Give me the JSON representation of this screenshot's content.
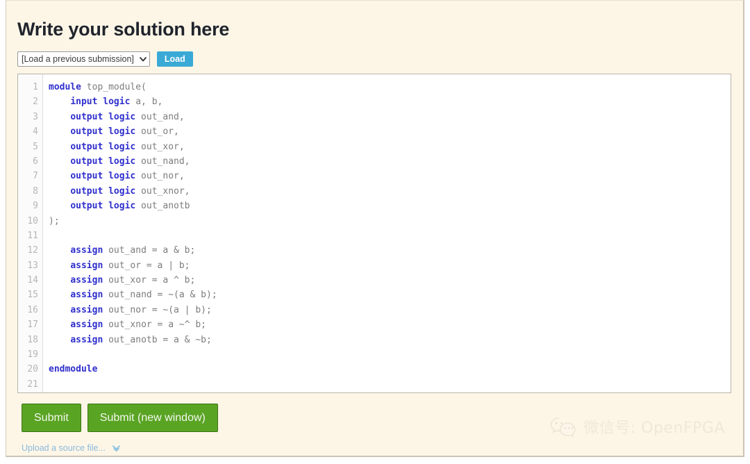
{
  "page": {
    "title": "Write your solution here",
    "background_color": "#fdf6e7"
  },
  "load_row": {
    "select_name": "previous-submission-select",
    "selected_option": "[Load a previous submission]",
    "options": [
      "[Load a previous submission]"
    ],
    "chevron_icon": "chevron-down-icon",
    "load_label": "Load",
    "load_color": "#3aa9d6"
  },
  "editor": {
    "language": "systemverilog",
    "line_count": 21,
    "keyword_color": "#2f2fcd",
    "text_color": "#7c7c7c",
    "gutter_color": "#b6b6b6",
    "line_numbers": [
      1,
      2,
      3,
      4,
      5,
      6,
      7,
      8,
      9,
      10,
      11,
      12,
      13,
      14,
      15,
      16,
      17,
      18,
      19,
      20,
      21
    ],
    "lines": [
      [
        {
          "t": "module",
          "k": true
        },
        {
          "t": " top_module(",
          "k": false
        }
      ],
      [
        {
          "t": "    ",
          "k": false
        },
        {
          "t": "input logic",
          "k": true
        },
        {
          "t": " a, b,",
          "k": false
        }
      ],
      [
        {
          "t": "    ",
          "k": false
        },
        {
          "t": "output logic",
          "k": true
        },
        {
          "t": " out_and,",
          "k": false
        }
      ],
      [
        {
          "t": "    ",
          "k": false
        },
        {
          "t": "output logic",
          "k": true
        },
        {
          "t": " out_or,",
          "k": false
        }
      ],
      [
        {
          "t": "    ",
          "k": false
        },
        {
          "t": "output logic",
          "k": true
        },
        {
          "t": " out_xor,",
          "k": false
        }
      ],
      [
        {
          "t": "    ",
          "k": false
        },
        {
          "t": "output logic",
          "k": true
        },
        {
          "t": " out_nand,",
          "k": false
        }
      ],
      [
        {
          "t": "    ",
          "k": false
        },
        {
          "t": "output logic",
          "k": true
        },
        {
          "t": " out_nor,",
          "k": false
        }
      ],
      [
        {
          "t": "    ",
          "k": false
        },
        {
          "t": "output logic",
          "k": true
        },
        {
          "t": " out_xnor,",
          "k": false
        }
      ],
      [
        {
          "t": "    ",
          "k": false
        },
        {
          "t": "output logic",
          "k": true
        },
        {
          "t": " out_anotb",
          "k": false
        }
      ],
      [
        {
          "t": ");",
          "k": false
        }
      ],
      [],
      [
        {
          "t": "    ",
          "k": false
        },
        {
          "t": "assign",
          "k": true
        },
        {
          "t": " out_and = a & b;",
          "k": false
        }
      ],
      [
        {
          "t": "    ",
          "k": false
        },
        {
          "t": "assign",
          "k": true
        },
        {
          "t": " out_or = a | b;",
          "k": false
        }
      ],
      [
        {
          "t": "    ",
          "k": false
        },
        {
          "t": "assign",
          "k": true
        },
        {
          "t": " out_xor = a ^ b;",
          "k": false
        }
      ],
      [
        {
          "t": "    ",
          "k": false
        },
        {
          "t": "assign",
          "k": true
        },
        {
          "t": " out_nand = ~(a & b);",
          "k": false
        }
      ],
      [
        {
          "t": "    ",
          "k": false
        },
        {
          "t": "assign",
          "k": true
        },
        {
          "t": " out_nor = ~(a | b);",
          "k": false
        }
      ],
      [
        {
          "t": "    ",
          "k": false
        },
        {
          "t": "assign",
          "k": true
        },
        {
          "t": " out_xnor = a ~^ b;",
          "k": false
        }
      ],
      [
        {
          "t": "    ",
          "k": false
        },
        {
          "t": "assign",
          "k": true
        },
        {
          "t": " out_anotb = a & ~b;",
          "k": false
        }
      ],
      [],
      [
        {
          "t": "endmodule",
          "k": true
        }
      ],
      []
    ]
  },
  "buttons": {
    "submit_label": "Submit",
    "submit_new_window_label": "Submit (new window)",
    "color": "#5aa424"
  },
  "upload": {
    "label": "Upload a source file...",
    "chevron_icon": "double-chevron-down-icon",
    "color": "#8ab9dc"
  },
  "watermark": {
    "logo_icon": "wechat-logo-icon",
    "text": "微信号: OpenFPGA",
    "color": "#efe7d7"
  }
}
